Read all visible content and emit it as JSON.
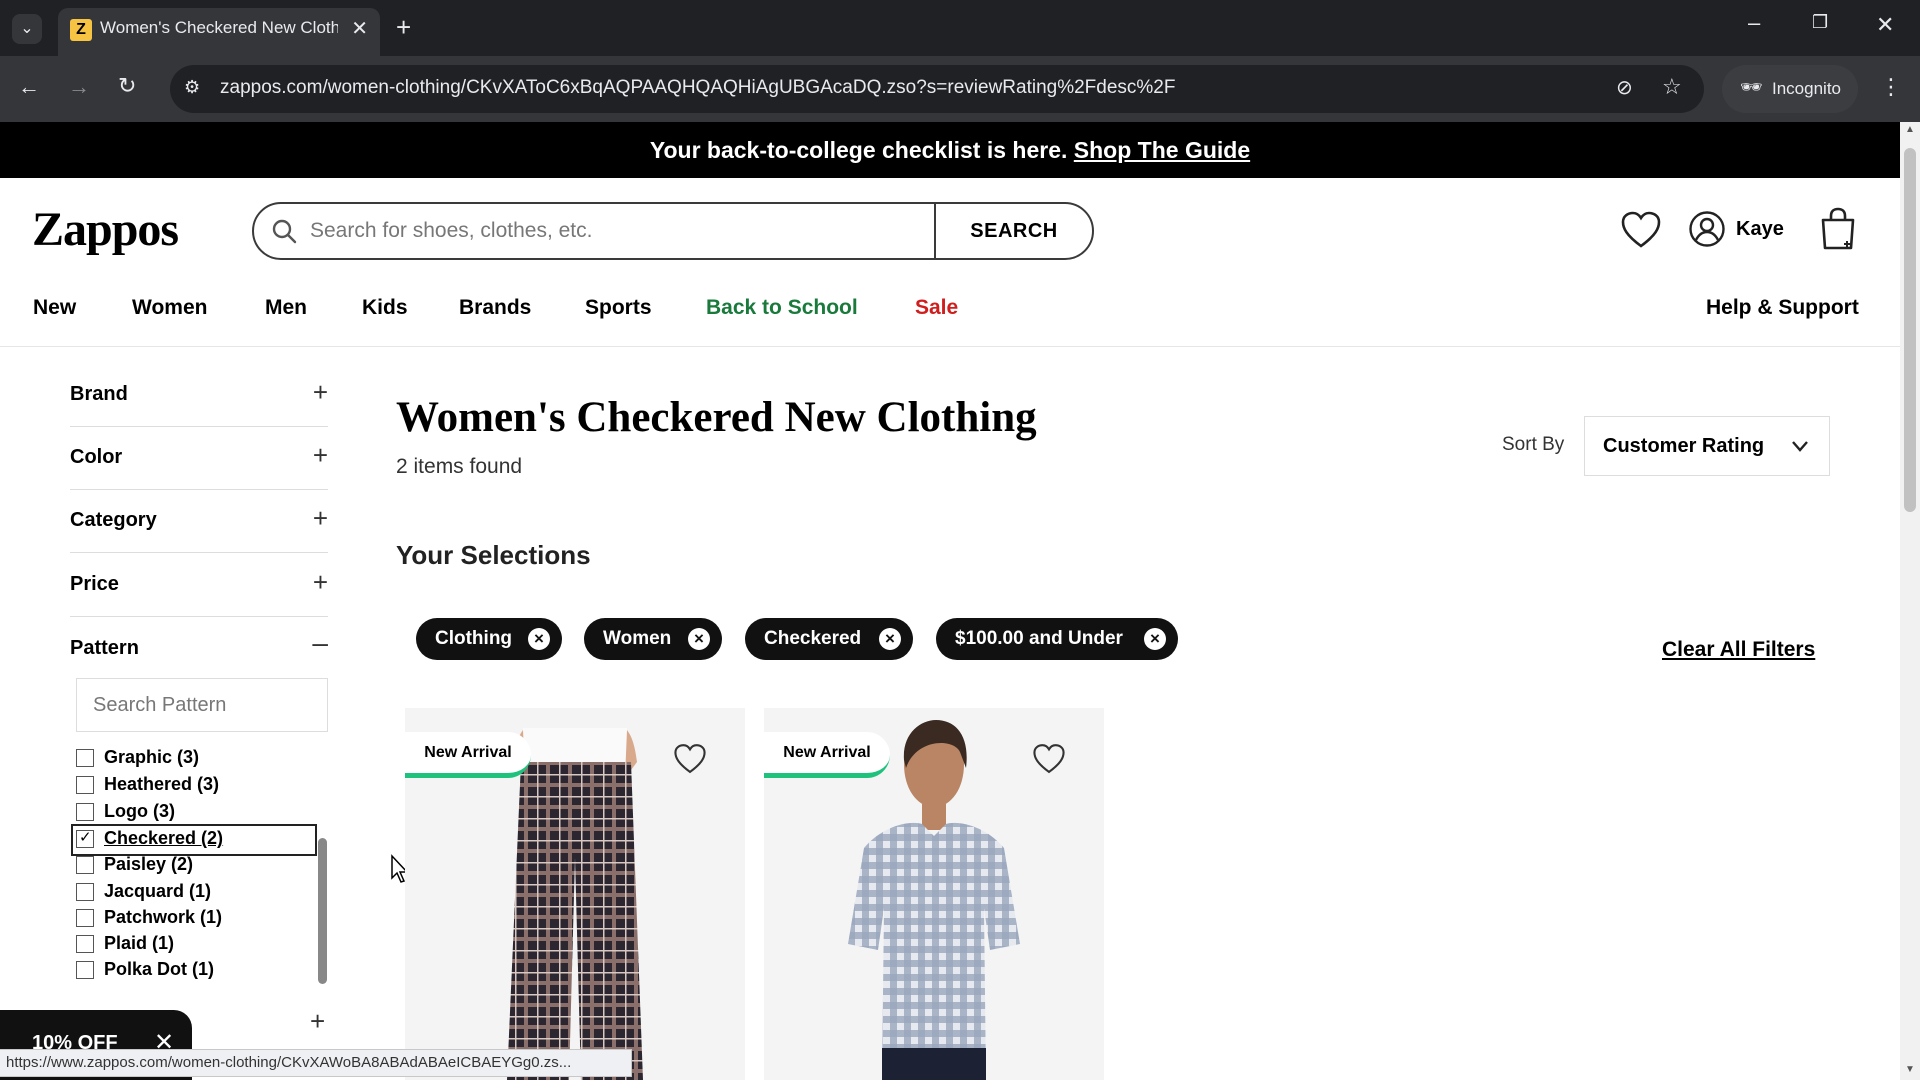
{
  "browser": {
    "tab_title": "Women's Checkered New Clothing",
    "favicon_letter": "Z",
    "url": "zappos.com/women-clothing/CKvXAToC6xBqAQPAAQHQAQHiAgUBGAcaDQ.zso?s=reviewRating%2Fdesc%2F",
    "incognito_label": "Incognito",
    "status_url": "https://www.zappos.com/women-clothing/CKvXAWoBA8ABAdABAeICBAEYGg0.zs..."
  },
  "promo": {
    "text": "Your back-to-college checklist is here.",
    "link": "Shop The Guide"
  },
  "header": {
    "logo": "Zappos",
    "search_placeholder": "Search for shoes, clothes, etc.",
    "search_button": "SEARCH",
    "account_name": "Kaye"
  },
  "nav": {
    "items": [
      "New",
      "Women",
      "Men",
      "Kids",
      "Brands",
      "Sports",
      "Back to School",
      "Sale"
    ],
    "help": "Help & Support",
    "colors": {
      "back_to_school": "#1a7a3c",
      "sale": "#d01d1d"
    }
  },
  "sidebar": {
    "facets": [
      "Brand",
      "Color",
      "Category",
      "Price",
      "Pattern"
    ],
    "pattern_search_placeholder": "Search Pattern",
    "pattern_options": [
      {
        "label": "Graphic (3)",
        "checked": false
      },
      {
        "label": "Heathered (3)",
        "checked": false
      },
      {
        "label": "Logo (3)",
        "checked": false
      },
      {
        "label": "Checkered (2)",
        "checked": true
      },
      {
        "label": "Paisley (2)",
        "checked": false
      },
      {
        "label": "Jacquard (1)",
        "checked": false
      },
      {
        "label": "Patchwork (1)",
        "checked": false
      },
      {
        "label": "Plaid (1)",
        "checked": false
      },
      {
        "label": "Polka Dot (1)",
        "checked": false
      }
    ]
  },
  "main": {
    "title": "Women's Checkered New Clothing",
    "count": "2 items found",
    "sort_label": "Sort By",
    "sort_value": "Customer Rating",
    "selections_heading": "Your Selections",
    "chips": [
      "Clothing",
      "Women",
      "Checkered",
      "$100.00 and Under"
    ],
    "clear_all": "Clear All Filters",
    "products": [
      {
        "badge": "New Arrival",
        "image": "checkered-wide-leg-pants"
      },
      {
        "badge": "New Arrival",
        "image": "checkered-short-sleeve-top"
      }
    ]
  },
  "offer": {
    "label": "10% OFF"
  },
  "icons": [
    "search-icon",
    "heart-icon",
    "account-icon",
    "cart-icon",
    "plus-icon",
    "minus-icon",
    "chevron-down-icon",
    "close-icon"
  ]
}
